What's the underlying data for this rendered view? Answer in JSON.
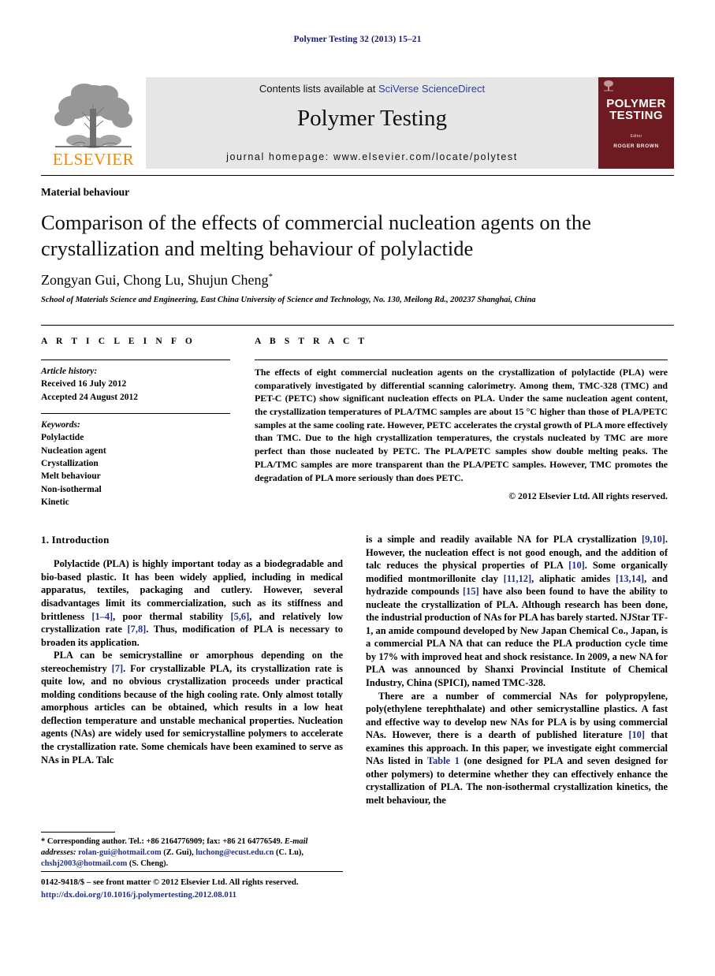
{
  "running_head": "Polymer Testing 32 (2013) 15–21",
  "masthead": {
    "contents_prefix": "Contents lists available at ",
    "sciencedirect_link": "SciVerse ScienceDirect",
    "journal_title": "Polymer Testing",
    "homepage": "journal homepage: www.elsevier.com/locate/polytest",
    "publisher_wordmark": "ELSEVIER",
    "cover": {
      "title_line1": "POLYMER",
      "title_line2": "TESTING",
      "editor_label": "Editor",
      "editor_name": "ROGER BROWN"
    }
  },
  "article": {
    "section_label": "Material behaviour",
    "title": "Comparison of the effects of commercial nucleation agents on the crystallization and melting behaviour of polylactide",
    "authors": "Zongyan Gui, Chong Lu, Shujun Cheng",
    "corresponding_marker": "*",
    "affiliation": "School of Materials Science and Engineering, East China University of Science and Technology, No. 130, Meilong Rd., 200237 Shanghai, China"
  },
  "info": {
    "heading": "A R T I C L E   I N F O",
    "history_label": "Article history:",
    "received": "Received 16 July 2012",
    "accepted": "Accepted 24 August 2012",
    "keywords_label": "Keywords:",
    "keywords": [
      "Polylactide",
      "Nucleation agent",
      "Crystallization",
      "Melt behaviour",
      "Non-isothermal",
      "Kinetic"
    ]
  },
  "abstract": {
    "heading": "A B S T R A C T",
    "text": "The effects of eight commercial nucleation agents on the crystallization of polylactide (PLA) were comparatively investigated by differential scanning calorimetry. Among them, TMC-328 (TMC) and PET-C (PETC) show significant nucleation effects on PLA. Under the same nucleation agent content, the crystallization temperatures of PLA/TMC samples are about 15 °C higher than those of PLA/PETC samples at the same cooling rate. However, PETC accelerates the crystal growth of PLA more effectively than TMC. Due to the high crystallization temperatures, the crystals nucleated by TMC are more perfect than those nucleated by PETC. The PLA/PETC samples show double melting peaks. The PLA/TMC samples are more transparent than the PLA/PETC samples. However, TMC promotes the degradation of PLA more seriously than does PETC.",
    "copyright": "© 2012 Elsevier Ltd. All rights reserved."
  },
  "body": {
    "intro_heading": "1. Introduction",
    "left_paragraphs": [
      {
        "segments": [
          {
            "t": "Polylactide (PLA) is highly important today as a biodegradable and bio-based plastic. It has been widely applied, including in medical apparatus, textiles, packaging and cutlery. However, several disadvantages limit its commercialization, such as its stiffness and brittleness ",
            "ref": false
          },
          {
            "t": "[1–4]",
            "ref": true
          },
          {
            "t": ", poor thermal stability ",
            "ref": false
          },
          {
            "t": "[5,6]",
            "ref": true
          },
          {
            "t": ", and relatively low crystallization rate ",
            "ref": false
          },
          {
            "t": "[7,8]",
            "ref": true
          },
          {
            "t": ". Thus, modification of PLA is necessary to broaden its application.",
            "ref": false
          }
        ]
      },
      {
        "segments": [
          {
            "t": "PLA can be semicrystalline or amorphous depending on the stereochemistry ",
            "ref": false
          },
          {
            "t": "[7]",
            "ref": true
          },
          {
            "t": ". For crystallizable PLA, its crystallization rate is quite low, and no obvious crystallization proceeds under practical molding conditions because of the high cooling rate. Only almost totally amorphous articles can be obtained, which results in a low heat deflection temperature and unstable mechanical properties. Nucleation agents (NAs) are widely used for semicrystalline polymers to accelerate the crystallization rate. Some chemicals have been examined to serve as NAs in PLA. Talc",
            "ref": false
          }
        ]
      }
    ],
    "right_paragraphs": [
      {
        "indent": false,
        "segments": [
          {
            "t": "is a simple and readily available NA for PLA crystallization ",
            "ref": false
          },
          {
            "t": "[9,10]",
            "ref": true
          },
          {
            "t": ". However, the nucleation effect is not good enough, and the addition of talc reduces the physical properties of PLA ",
            "ref": false
          },
          {
            "t": "[10]",
            "ref": true
          },
          {
            "t": ". Some organically modified montmorillonite clay ",
            "ref": false
          },
          {
            "t": "[11,12]",
            "ref": true
          },
          {
            "t": ", aliphatic amides ",
            "ref": false
          },
          {
            "t": "[13,14]",
            "ref": true
          },
          {
            "t": ", and hydrazide compounds ",
            "ref": false
          },
          {
            "t": "[15]",
            "ref": true
          },
          {
            "t": " have also been found to have the ability to nucleate the crystallization of PLA. Although research has been done, the industrial production of NAs for PLA has barely started. NJStar TF-1, an amide compound developed by New Japan Chemical Co., Japan, is a commercial PLA NA that can reduce the PLA production cycle time by 17% with improved heat and shock resistance. In 2009, a new NA for PLA was announced by Shanxi Provincial Institute of Chemical Industry, China (SPICI), named TMC-328.",
            "ref": false
          }
        ]
      },
      {
        "indent": true,
        "segments": [
          {
            "t": "There are a number of commercial NAs for polypropylene, poly(ethylene terephthalate) and other semicrystalline plastics. A fast and effective way to develop new NAs for PLA is by using commercial NAs. However, there is a dearth of published literature ",
            "ref": false
          },
          {
            "t": "[10]",
            "ref": true
          },
          {
            "t": " that examines this approach. In this paper, we investigate eight commercial NAs listed in ",
            "ref": false
          },
          {
            "t": "Table 1",
            "ref": true
          },
          {
            "t": " (one designed for PLA and seven designed for other polymers) to determine whether they can effectively enhance the crystallization of PLA. The non-isothermal crystallization kinetics, the melt behaviour, the",
            "ref": false
          }
        ]
      }
    ]
  },
  "footnote": {
    "marker": "*",
    "corresponding": "Corresponding author. Tel.: +86 2164776909; fax: +86 21 64776549.",
    "email_label": "E-mail addresses:",
    "emails": [
      {
        "address": "rolan-gui@hotmail.com",
        "owner": "(Z. Gui)"
      },
      {
        "address": "luchong@ecust.edu.cn",
        "owner": "(C. Lu)"
      },
      {
        "address": "chshj2003@hotmail.com",
        "owner": "(S. Cheng)"
      }
    ]
  },
  "imprint": {
    "front_matter": "0142-9418/$ – see front matter © 2012 Elsevier Ltd. All rights reserved.",
    "doi": "http://dx.doi.org/10.1016/j.polymertesting.2012.08.011"
  },
  "colors": {
    "running_head": "#1a1a6e",
    "link_blue": "#1f2f8c",
    "elsevier_orange": "#f08a00",
    "cover_maroon": "#6d1b20",
    "banner_gray": "#e6e6e6"
  }
}
